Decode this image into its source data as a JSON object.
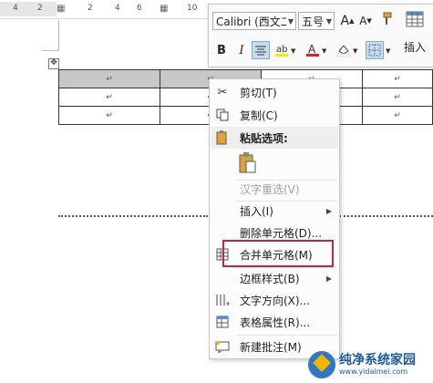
{
  "ruler": {
    "numbers": [
      "4",
      "2",
      "2",
      "4",
      "6",
      "10"
    ]
  },
  "mini_toolbar": {
    "font_name": "Calibri (西文二",
    "font_size": "五号",
    "insert_label": "插入",
    "font_color": "#e02020",
    "highlight_color": "#ffe600",
    "icons": [
      "grow-font-icon",
      "shrink-font-icon",
      "format-painter-icon",
      "table-styles-icon",
      "bold-icon",
      "italic-icon",
      "center-align-icon",
      "highlight-icon",
      "font-color-icon",
      "shading-icon",
      "borders-icon"
    ],
    "bold": "B",
    "italic": "I"
  },
  "table": {
    "cell_mark": "↵"
  },
  "context_menu": {
    "items": [
      {
        "label": "剪切(T)",
        "icon": "scissors-icon"
      },
      {
        "label": "复制(C)",
        "icon": "copy-icon"
      },
      {
        "label": "粘贴选项:",
        "icon": "paste-icon"
      },
      {
        "label": "汉字重选(V)",
        "icon": ""
      },
      {
        "label": "插入(I)",
        "icon": ""
      },
      {
        "label": "删除单元格(D)...",
        "icon": ""
      },
      {
        "label": "合并单元格(M)",
        "icon": "merge-cells-icon"
      },
      {
        "label": "边框样式(B)",
        "icon": ""
      },
      {
        "label": "文字方向(X)...",
        "icon": "text-direction-icon"
      },
      {
        "label": "表格属性(R)...",
        "icon": "table-properties-icon"
      },
      {
        "label": "新建批注(M)",
        "icon": "new-comment-icon"
      }
    ],
    "highlight_color": "#c0254a"
  },
  "watermark": {
    "title": "纯净系统家园",
    "url": "www.yidaimei.com"
  }
}
